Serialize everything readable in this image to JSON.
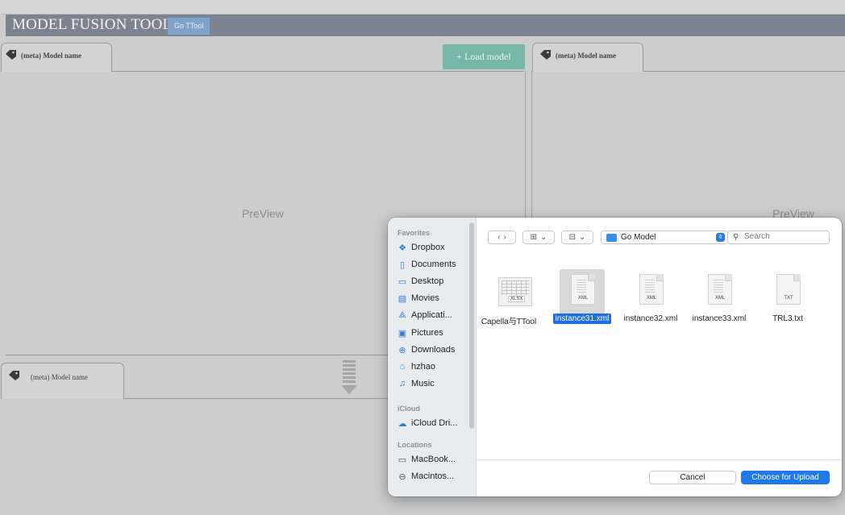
{
  "app": {
    "title": "MODEL FUSION TOOL",
    "go_ttool_label": "Go TTool",
    "load_model_label": "+ Load model"
  },
  "panels": [
    {
      "tab_label": "(meta) Model name",
      "preview_label": "PreView"
    },
    {
      "tab_label": "(meta) Model name",
      "preview_label": "PreView"
    },
    {
      "tab_label": "(meta) Model name"
    }
  ],
  "dialog": {
    "sidebar": {
      "favorites_header": "Favorites",
      "favorites": [
        {
          "label": "Dropbox",
          "icon": "dropbox-icon"
        },
        {
          "label": "Documents",
          "icon": "document-icon"
        },
        {
          "label": "Desktop",
          "icon": "desktop-icon"
        },
        {
          "label": "Movies",
          "icon": "film-icon"
        },
        {
          "label": "Applicati...",
          "icon": "applications-icon"
        },
        {
          "label": "Pictures",
          "icon": "pictures-icon"
        },
        {
          "label": "Downloads",
          "icon": "download-icon"
        },
        {
          "label": "hzhao",
          "icon": "home-icon"
        },
        {
          "label": "Music",
          "icon": "music-icon"
        }
      ],
      "icloud_header": "iCloud",
      "icloud": [
        {
          "label": "iCloud Dri...",
          "icon": "cloud-icon"
        }
      ],
      "locations_header": "Locations",
      "locations": [
        {
          "label": "MacBook...",
          "icon": "laptop-icon"
        },
        {
          "label": "Macintos...",
          "icon": "disk-icon"
        }
      ]
    },
    "toolbar": {
      "location": "Go Model",
      "search_placeholder": "Search"
    },
    "files": [
      {
        "name": "Capella与TTool",
        "ext": "XLSX",
        "selected": false
      },
      {
        "name": "instance31.xml",
        "ext": "XML",
        "selected": true
      },
      {
        "name": "instance32.xml",
        "ext": "XML",
        "selected": false
      },
      {
        "name": "instance33.xml",
        "ext": "XML",
        "selected": false
      },
      {
        "name": "TRL3.txt",
        "ext": "TXT",
        "selected": false
      }
    ],
    "cancel_label": "Cancel",
    "choose_label": "Choose for Upload"
  }
}
